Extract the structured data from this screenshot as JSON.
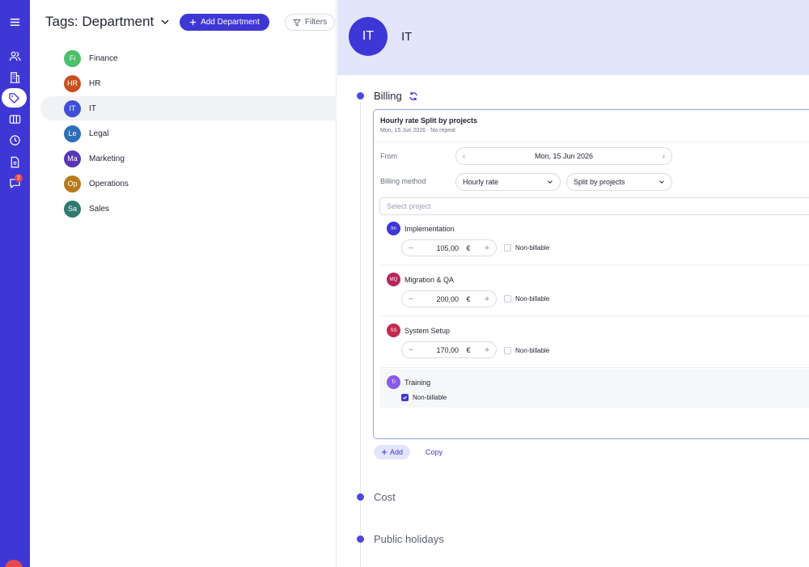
{
  "rail": {
    "icons": [
      "menu-icon",
      "users-icon",
      "building-icon",
      "tag-icon",
      "board-icon",
      "clock-icon",
      "document-icon",
      "chat-icon"
    ],
    "chat_badge": "2"
  },
  "list": {
    "title": "Tags: Department",
    "add_button": "Add Department",
    "filters_button": "Filters",
    "tags": [
      {
        "abbr": "Fi",
        "label": "Finance",
        "color": "#4cbf6a"
      },
      {
        "abbr": "HR",
        "label": "HR",
        "color": "#c8501f"
      },
      {
        "abbr": "IT",
        "label": "IT",
        "color": "#3f4fd6"
      },
      {
        "abbr": "Le",
        "label": "Legal",
        "color": "#2f6fb8"
      },
      {
        "abbr": "Ma",
        "label": "Marketing",
        "color": "#5a35b8"
      },
      {
        "abbr": "Op",
        "label": "Operations",
        "color": "#b87a1a"
      },
      {
        "abbr": "Sa",
        "label": "Sales",
        "color": "#2f7a72"
      }
    ]
  },
  "detail": {
    "abbr": "IT",
    "name": "IT",
    "sections": {
      "billing": "Billing",
      "cost": "Cost",
      "public_holidays": "Public holidays"
    },
    "billing_card": {
      "title": "Hourly rate Split by projects",
      "subtitle": "Mon, 15 Jun 2026 · No repeat",
      "from_label": "From",
      "from_value": "Mon, 15 Jun 2026",
      "method_label": "Billing method",
      "method_value": "Hourly rate",
      "split_value": "Split by projects",
      "project_placeholder": "Select project",
      "projects": [
        {
          "abbr": "Im",
          "name": "Implementation",
          "rate": "105,00",
          "currency": "€",
          "non_billable_label": "Non-billable",
          "color": "#3f36d6"
        },
        {
          "abbr": "MQ",
          "name": "Migration & QA",
          "rate": "200,00",
          "currency": "€",
          "non_billable_label": "Non-billable",
          "color": "#b8245a"
        },
        {
          "abbr": "SS",
          "name": "System Setup",
          "rate": "170,00",
          "currency": "€",
          "non_billable_label": "Non-billable",
          "color": "#c4284f"
        },
        {
          "abbr": "Tr",
          "name": "Training",
          "non_billable_label": "Non-billable",
          "color": "#8a5ae6"
        }
      ]
    },
    "add_label": "Add",
    "copy_label": "Copy"
  }
}
